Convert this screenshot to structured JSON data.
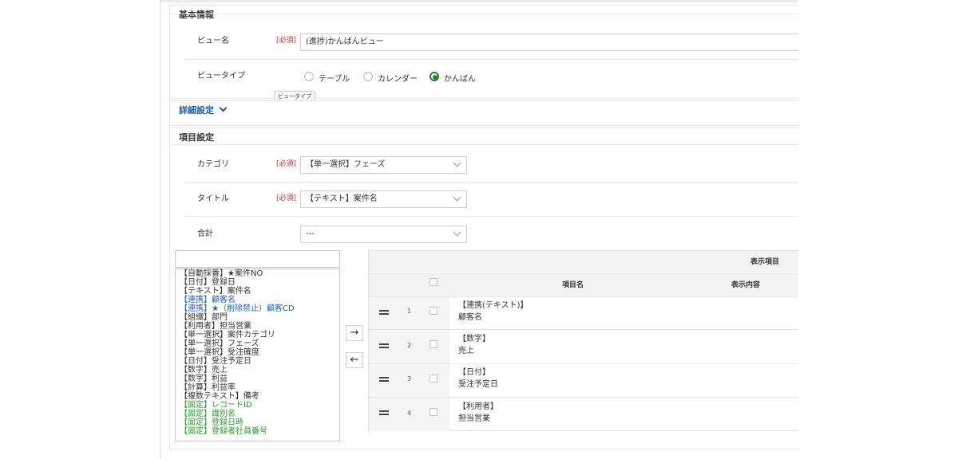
{
  "basic_section": {
    "title": "基本情報",
    "view_name_label": "ビュー名",
    "required": "[必須]",
    "view_name_value": "(進捗)かんばんビュー",
    "view_type_label": "ビュータイプ",
    "view_type_options": [
      "テーブル",
      "カレンダー",
      "かんばん"
    ],
    "view_type_selected": "かんばん",
    "tooltip": "ビュータイプ"
  },
  "detail_section": {
    "title": "詳細設定"
  },
  "items_section": {
    "title": "項目設定",
    "category_label": "カテゴリ",
    "category_value": "【単一選択】フェーズ",
    "title_label": "タイトル",
    "title_value": "【テキスト】案件名",
    "total_label": "合計",
    "total_value": "---",
    "required": "[必須]"
  },
  "field_search": {
    "value": ""
  },
  "field_list": [
    {
      "text": "【自動採番】★案件NO",
      "color": "#333333"
    },
    {
      "text": "【日付】登録日",
      "color": "#333333"
    },
    {
      "text": "【テキスト】案件名",
      "color": "#333333"
    },
    {
      "text": "【連携】顧客名",
      "color": "#1f5fc2"
    },
    {
      "text": "【連携】★（削除禁止）顧客CD",
      "color": "#1f5fc2"
    },
    {
      "text": "【組織】部門",
      "color": "#333333"
    },
    {
      "text": "【利用者】担当営業",
      "color": "#333333"
    },
    {
      "text": "【単一選択】案件カテゴリ",
      "color": "#333333"
    },
    {
      "text": "【単一選択】フェーズ",
      "color": "#333333"
    },
    {
      "text": "【単一選択】受注確度",
      "color": "#333333"
    },
    {
      "text": "【日付】受注予定日",
      "color": "#333333"
    },
    {
      "text": "【数字】売上",
      "color": "#333333"
    },
    {
      "text": "【数字】利益",
      "color": "#333333"
    },
    {
      "text": "【計算】利益率",
      "color": "#333333"
    },
    {
      "text": "【複数テキスト】備考",
      "color": "#333333"
    },
    {
      "text": "【固定】レコードID",
      "color": "#2aa02a"
    },
    {
      "text": "【固定】識別名",
      "color": "#2aa02a"
    },
    {
      "text": "【固定】登録日時",
      "color": "#2aa02a"
    },
    {
      "text": "【固定】登録者社員番号",
      "color": "#2aa02a"
    }
  ],
  "transfer_buttons": {
    "add": "→",
    "remove": "←"
  },
  "display_table": {
    "group_header": "表示項目",
    "col_item_name": "項目名",
    "col_display_content": "表示内容",
    "rows": [
      {
        "num": "1",
        "type": "【連携(テキスト)】",
        "name": "顧客名"
      },
      {
        "num": "2",
        "type": "【数字】",
        "name": "売上"
      },
      {
        "num": "3",
        "type": "【日付】",
        "name": "受注予定日"
      },
      {
        "num": "4",
        "type": "【利用者】",
        "name": "担当営業"
      }
    ]
  }
}
